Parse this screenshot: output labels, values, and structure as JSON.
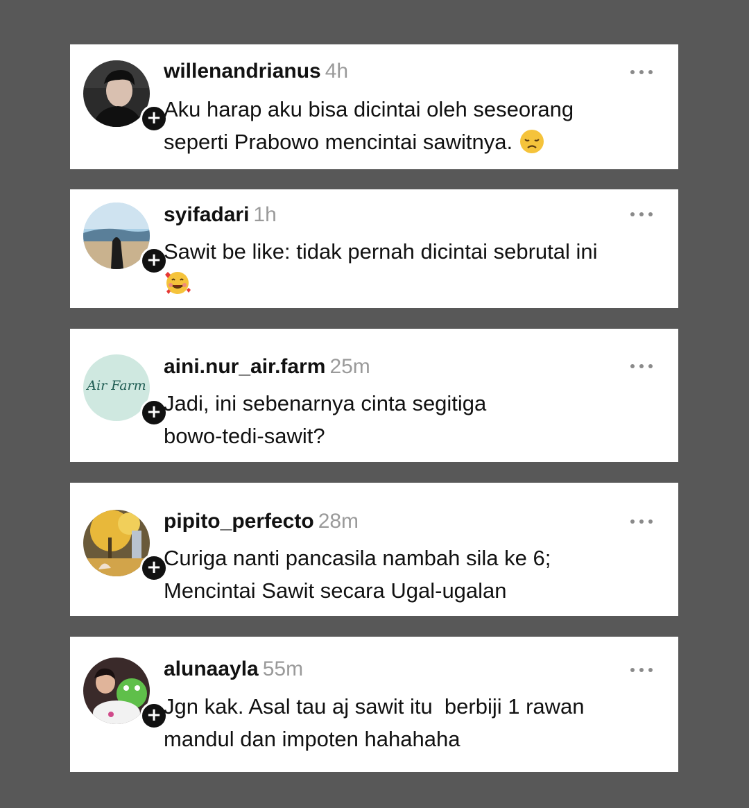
{
  "comments": [
    {
      "username": "willenandrianus",
      "time": "4h",
      "lines": [
        "Aku harap aku bisa dicintai oleh seseorang",
        "seperti Prabowo mencintai sawitnya."
      ],
      "emoji": "disappointed-face"
    },
    {
      "username": "syifadari",
      "time": "1h",
      "lines": [
        "Sawit be like: tidak pernah dicintai sebrutal ini",
        ""
      ],
      "emoji": "smiling-face-with-hearts"
    },
    {
      "username": "aini.nur_air.farm",
      "time": "25m",
      "avatar_text": "Air Farm",
      "lines": [
        "Jadi, ini sebenarnya cinta segitiga",
        "bowo-tedi-sawit?"
      ]
    },
    {
      "username": "pipito_perfecto",
      "time": "28m",
      "lines": [
        "Curiga nanti pancasila nambah sila ke 6;",
        "Mencintai Sawit secara Ugal-ugalan"
      ]
    },
    {
      "username": "alunaayla",
      "time": "55m",
      "lines": [
        "Jgn kak. Asal tau aj sawit itu  berbiji 1 rawan",
        "mandul dan impoten hahahaha"
      ]
    }
  ],
  "icons": {
    "follow": "plus-icon",
    "more": "more-horizontal-icon"
  },
  "colors": {
    "background": "#585858",
    "card": "#ffffff",
    "username": "#111111",
    "timestamp": "#9a9a9a",
    "follow_badge": "#111111"
  }
}
